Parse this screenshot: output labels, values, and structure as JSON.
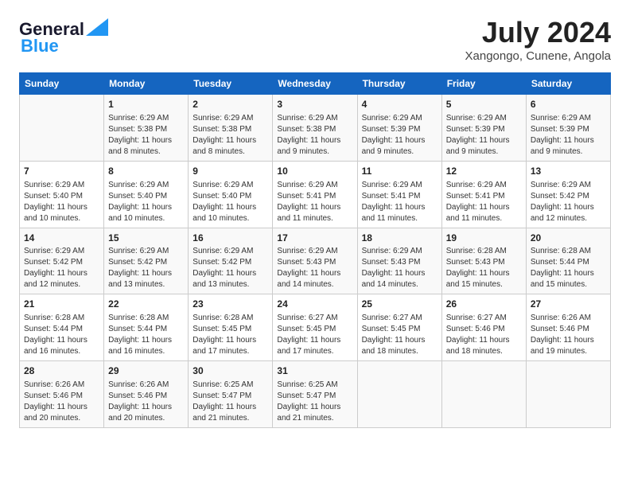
{
  "header": {
    "logo_line1": "General",
    "logo_line2": "Blue",
    "month": "July 2024",
    "location": "Xangongo, Cunene, Angola"
  },
  "days_of_week": [
    "Sunday",
    "Monday",
    "Tuesday",
    "Wednesday",
    "Thursday",
    "Friday",
    "Saturday"
  ],
  "weeks": [
    [
      {
        "day": "",
        "info": ""
      },
      {
        "day": "1",
        "info": "Sunrise: 6:29 AM\nSunset: 5:38 PM\nDaylight: 11 hours\nand 8 minutes."
      },
      {
        "day": "2",
        "info": "Sunrise: 6:29 AM\nSunset: 5:38 PM\nDaylight: 11 hours\nand 8 minutes."
      },
      {
        "day": "3",
        "info": "Sunrise: 6:29 AM\nSunset: 5:38 PM\nDaylight: 11 hours\nand 9 minutes."
      },
      {
        "day": "4",
        "info": "Sunrise: 6:29 AM\nSunset: 5:39 PM\nDaylight: 11 hours\nand 9 minutes."
      },
      {
        "day": "5",
        "info": "Sunrise: 6:29 AM\nSunset: 5:39 PM\nDaylight: 11 hours\nand 9 minutes."
      },
      {
        "day": "6",
        "info": "Sunrise: 6:29 AM\nSunset: 5:39 PM\nDaylight: 11 hours\nand 9 minutes."
      }
    ],
    [
      {
        "day": "7",
        "info": "Sunrise: 6:29 AM\nSunset: 5:40 PM\nDaylight: 11 hours\nand 10 minutes."
      },
      {
        "day": "8",
        "info": "Sunrise: 6:29 AM\nSunset: 5:40 PM\nDaylight: 11 hours\nand 10 minutes."
      },
      {
        "day": "9",
        "info": "Sunrise: 6:29 AM\nSunset: 5:40 PM\nDaylight: 11 hours\nand 10 minutes."
      },
      {
        "day": "10",
        "info": "Sunrise: 6:29 AM\nSunset: 5:41 PM\nDaylight: 11 hours\nand 11 minutes."
      },
      {
        "day": "11",
        "info": "Sunrise: 6:29 AM\nSunset: 5:41 PM\nDaylight: 11 hours\nand 11 minutes."
      },
      {
        "day": "12",
        "info": "Sunrise: 6:29 AM\nSunset: 5:41 PM\nDaylight: 11 hours\nand 11 minutes."
      },
      {
        "day": "13",
        "info": "Sunrise: 6:29 AM\nSunset: 5:42 PM\nDaylight: 11 hours\nand 12 minutes."
      }
    ],
    [
      {
        "day": "14",
        "info": "Sunrise: 6:29 AM\nSunset: 5:42 PM\nDaylight: 11 hours\nand 12 minutes."
      },
      {
        "day": "15",
        "info": "Sunrise: 6:29 AM\nSunset: 5:42 PM\nDaylight: 11 hours\nand 13 minutes."
      },
      {
        "day": "16",
        "info": "Sunrise: 6:29 AM\nSunset: 5:42 PM\nDaylight: 11 hours\nand 13 minutes."
      },
      {
        "day": "17",
        "info": "Sunrise: 6:29 AM\nSunset: 5:43 PM\nDaylight: 11 hours\nand 14 minutes."
      },
      {
        "day": "18",
        "info": "Sunrise: 6:29 AM\nSunset: 5:43 PM\nDaylight: 11 hours\nand 14 minutes."
      },
      {
        "day": "19",
        "info": "Sunrise: 6:28 AM\nSunset: 5:43 PM\nDaylight: 11 hours\nand 15 minutes."
      },
      {
        "day": "20",
        "info": "Sunrise: 6:28 AM\nSunset: 5:44 PM\nDaylight: 11 hours\nand 15 minutes."
      }
    ],
    [
      {
        "day": "21",
        "info": "Sunrise: 6:28 AM\nSunset: 5:44 PM\nDaylight: 11 hours\nand 16 minutes."
      },
      {
        "day": "22",
        "info": "Sunrise: 6:28 AM\nSunset: 5:44 PM\nDaylight: 11 hours\nand 16 minutes."
      },
      {
        "day": "23",
        "info": "Sunrise: 6:28 AM\nSunset: 5:45 PM\nDaylight: 11 hours\nand 17 minutes."
      },
      {
        "day": "24",
        "info": "Sunrise: 6:27 AM\nSunset: 5:45 PM\nDaylight: 11 hours\nand 17 minutes."
      },
      {
        "day": "25",
        "info": "Sunrise: 6:27 AM\nSunset: 5:45 PM\nDaylight: 11 hours\nand 18 minutes."
      },
      {
        "day": "26",
        "info": "Sunrise: 6:27 AM\nSunset: 5:46 PM\nDaylight: 11 hours\nand 18 minutes."
      },
      {
        "day": "27",
        "info": "Sunrise: 6:26 AM\nSunset: 5:46 PM\nDaylight: 11 hours\nand 19 minutes."
      }
    ],
    [
      {
        "day": "28",
        "info": "Sunrise: 6:26 AM\nSunset: 5:46 PM\nDaylight: 11 hours\nand 20 minutes."
      },
      {
        "day": "29",
        "info": "Sunrise: 6:26 AM\nSunset: 5:46 PM\nDaylight: 11 hours\nand 20 minutes."
      },
      {
        "day": "30",
        "info": "Sunrise: 6:25 AM\nSunset: 5:47 PM\nDaylight: 11 hours\nand 21 minutes."
      },
      {
        "day": "31",
        "info": "Sunrise: 6:25 AM\nSunset: 5:47 PM\nDaylight: 11 hours\nand 21 minutes."
      },
      {
        "day": "",
        "info": ""
      },
      {
        "day": "",
        "info": ""
      },
      {
        "day": "",
        "info": ""
      }
    ]
  ]
}
